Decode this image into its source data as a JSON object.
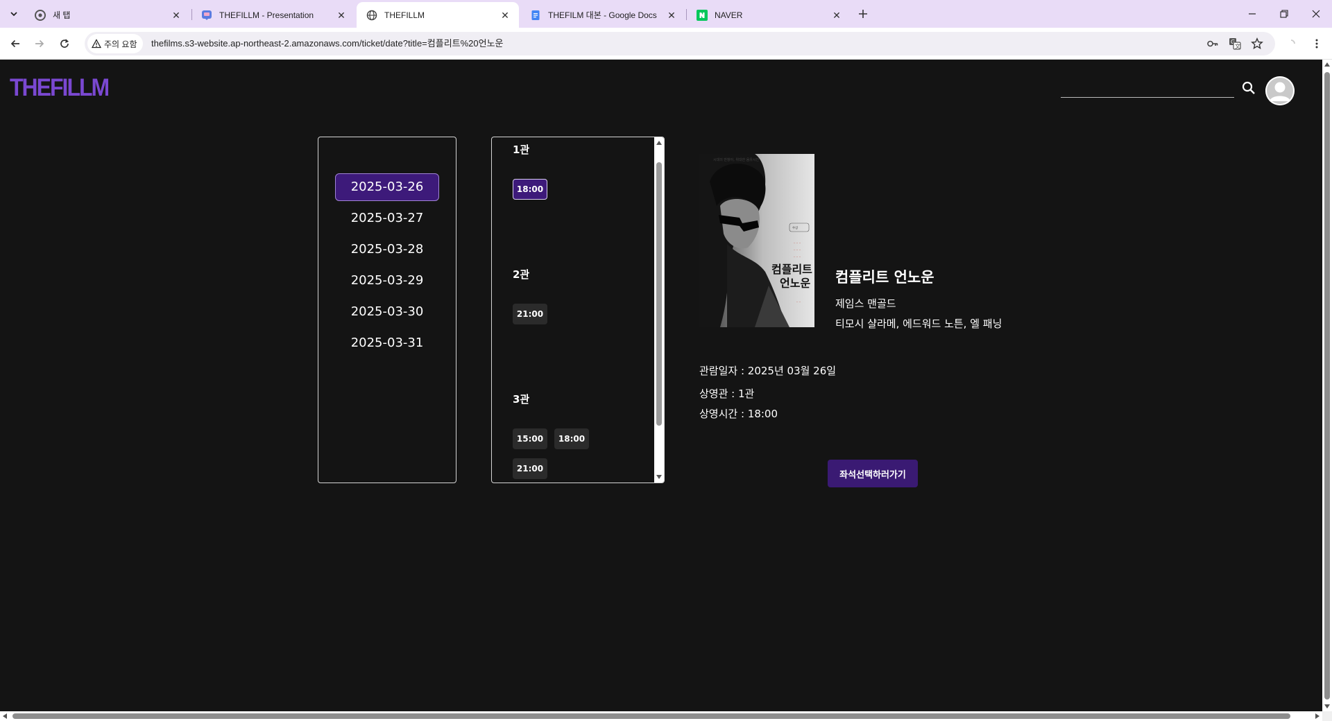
{
  "browser": {
    "tabs": [
      {
        "title": "새 탭",
        "icon": "chrome-icon",
        "active": false
      },
      {
        "title": "THEFILLM - Presentation",
        "icon": "presentation-app-icon",
        "active": false
      },
      {
        "title": "THEFILLM",
        "icon": "globe-icon",
        "active": true
      },
      {
        "title": "THEFILM 대본 - Google Docs",
        "icon": "google-docs-icon",
        "active": false
      },
      {
        "title": "NAVER",
        "icon": "naver-icon",
        "active": false
      }
    ],
    "security_chip": "주의 요함",
    "url": "thefilms.s3-website.ap-northeast-2.amazonaws.com/ticket/date?title=컴플리트%20언노운"
  },
  "header": {
    "logo": "THEFILLM",
    "search_placeholder": ""
  },
  "dates": [
    "2025-03-26",
    "2025-03-27",
    "2025-03-28",
    "2025-03-29",
    "2025-03-30",
    "2025-03-31"
  ],
  "selected_date_index": 0,
  "halls": [
    {
      "name": "1관",
      "times": [
        "18:00"
      ]
    },
    {
      "name": "2관",
      "times": [
        "21:00"
      ]
    },
    {
      "name": "3관",
      "times": [
        "15:00",
        "18:00",
        "21:00"
      ]
    }
  ],
  "selected_slot": {
    "hall_index": 0,
    "time_index": 0
  },
  "movie": {
    "title": "컴플리트 언노운",
    "director": "제임스 맨골드",
    "cast": "티모시 샬라메, 에드워드 노튼, 엘 패닝",
    "poster_title": "컴플리트 언노운"
  },
  "booking": {
    "date_line": "관람일자 : 2025년 03월 26일",
    "hall_line": "상영관 : 1관",
    "time_line": "상영시간 : 18:00",
    "button": "좌석선택하러가기"
  },
  "colors": {
    "accent": "#3d1a7a",
    "logo": "#7a48d1",
    "background": "#141414",
    "tab_strip": "#e9dcf7"
  }
}
